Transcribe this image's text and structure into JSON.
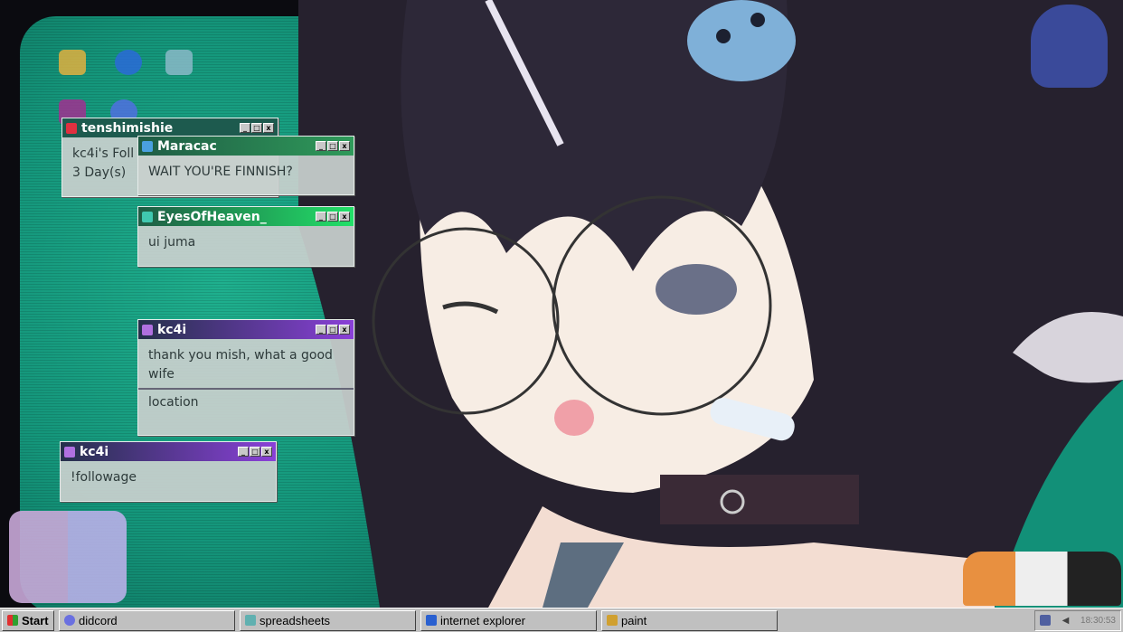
{
  "desktop": {
    "icons": [
      "folder-icon",
      "ie-icon",
      "notepad-icon",
      "paint-icon",
      "globe-icon"
    ]
  },
  "chat": [
    {
      "user": "tenshimishie",
      "message_lines": [
        "kc4i's Foll",
        "3 Day(s)"
      ],
      "title_color": "#1d5a4e"
    },
    {
      "user": "Maracac",
      "message_lines": [
        "WAIT YOU'RE FINNISH?"
      ],
      "title_color": "#2a8a52"
    },
    {
      "user": "EyesOfHeaven_",
      "message_lines": [
        "ui juma"
      ],
      "title_color": "#22d060"
    },
    {
      "user": "kc4i",
      "message_lines": [
        "thank you mish, what a good",
        "wife",
        "location"
      ],
      "title_color": "#7a3cc8"
    },
    {
      "user": "kc4i",
      "message_lines": [
        "!followage"
      ],
      "title_color": "#7a3cc8"
    }
  ],
  "taskbar": {
    "start": "Start",
    "apps": [
      "didcord",
      "spreadsheets",
      "internet explorer",
      "paint"
    ],
    "clock": "18:30:53"
  },
  "window_controls": {
    "min": "_",
    "max": "□",
    "close": "x"
  }
}
